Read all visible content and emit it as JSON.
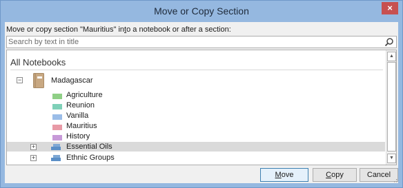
{
  "window": {
    "title": "Move or Copy Section",
    "close_glyph": "×"
  },
  "instruction": {
    "prefix": "Move or copy section \"Mauritius\" in",
    "accel": "t",
    "suffix": "o a notebook or after a section:"
  },
  "search": {
    "placeholder": "Search by text in title",
    "value": "",
    "icon": "search-icon"
  },
  "tree": {
    "header": "All Notebooks",
    "notebook": {
      "name": "Madagascar",
      "expander": "−",
      "icon": "notebook-icon",
      "icon_color": "#c8a882"
    },
    "sections": [
      {
        "label": "Agriculture",
        "color": "#8fcf86"
      },
      {
        "label": "Reunion",
        "color": "#7fd0b8"
      },
      {
        "label": "Vanilla",
        "color": "#9bbde8"
      },
      {
        "label": "Mauritius",
        "color": "#e89aa6"
      },
      {
        "label": "History",
        "color": "#c79ad8"
      }
    ],
    "groups": [
      {
        "label": "Essential Oils",
        "expander": "+",
        "selected": true
      },
      {
        "label": "Ethnic Groups",
        "expander": "+",
        "selected": false
      }
    ]
  },
  "buttons": {
    "move": {
      "accel": "M",
      "rest": "ove"
    },
    "copy": {
      "accel": "C",
      "rest": "opy"
    },
    "cancel": {
      "label": "Cancel"
    }
  }
}
